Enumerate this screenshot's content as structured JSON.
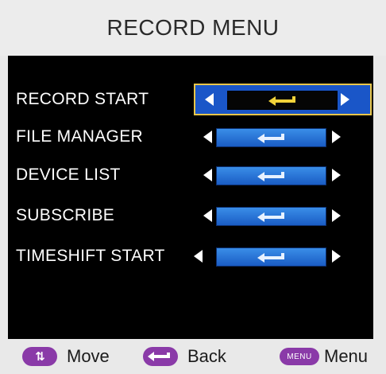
{
  "title": "RECORD MENU",
  "items": [
    {
      "label": "RECORD START",
      "action_icon": "enter-icon",
      "selected": true
    },
    {
      "label": "FILE MANAGER",
      "action_icon": "enter-icon",
      "selected": false
    },
    {
      "label": "DEVICE LIST",
      "action_icon": "enter-icon",
      "selected": false
    },
    {
      "label": "SUBSCRIBE",
      "action_icon": "enter-icon",
      "selected": false
    },
    {
      "label": "TIMESHIFT START",
      "action_icon": "enter-icon",
      "selected": false
    }
  ],
  "footer": {
    "move": {
      "key_text": "⇅",
      "label": "Move",
      "icon": "updown-icon"
    },
    "back": {
      "label": "Back",
      "icon": "enter-icon"
    },
    "menu": {
      "key_text": "MENU",
      "label": "Menu"
    }
  },
  "colors": {
    "panel_bg": "#000000",
    "title_bg": "#ececec",
    "value_bar": "#2f82e0",
    "selected_bg": "#1a56c8",
    "selected_border": "#e8c64a",
    "selected_glyph": "#f1d23a",
    "footer_key": "#8a3aa8"
  }
}
